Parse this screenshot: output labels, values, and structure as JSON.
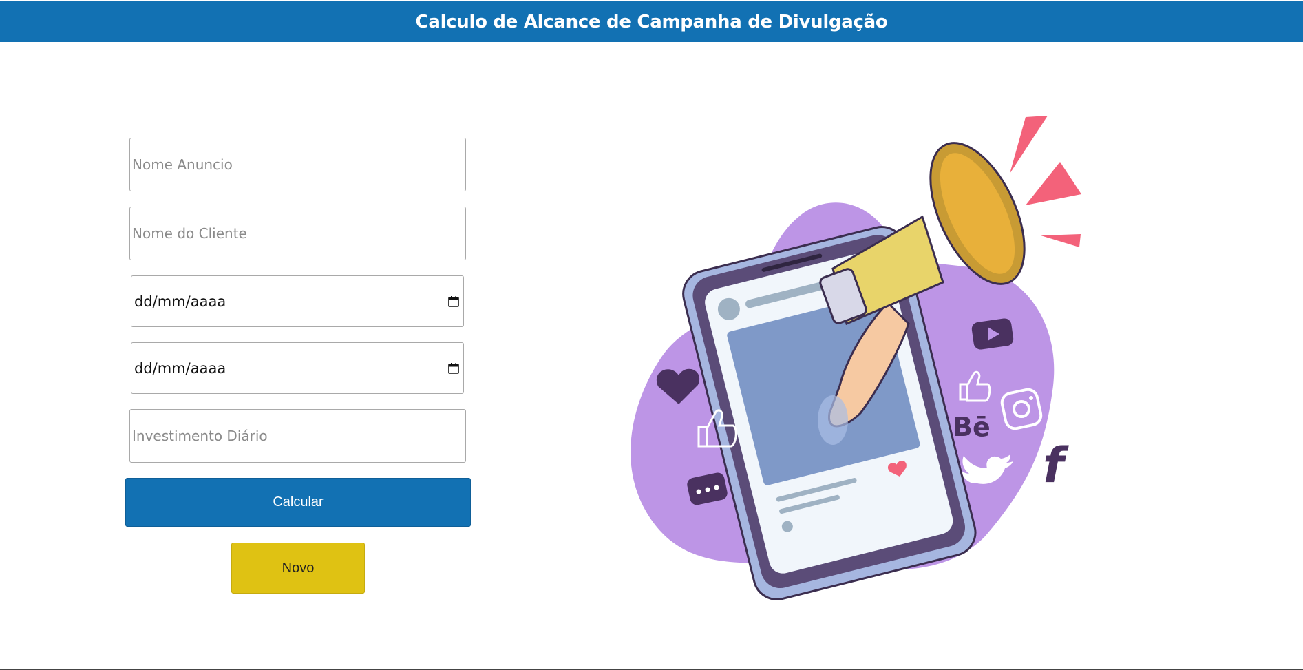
{
  "header": {
    "title": "Calculo de Alcance de Campanha de Divulgação",
    "bg_color": "#1271b3"
  },
  "form": {
    "nome_anuncio": {
      "placeholder": "Nome Anuncio",
      "value": ""
    },
    "nome_cliente": {
      "placeholder": "Nome do Cliente",
      "value": ""
    },
    "data_inicio": {
      "display": "dd/mm/aaaa"
    },
    "data_fim": {
      "display": "dd/mm/aaaa"
    },
    "investimento": {
      "placeholder": "Investimento Diário",
      "value": ""
    },
    "calcular_label": "Calcular",
    "novo_label": "Novo"
  },
  "illustration": {
    "description_icons": [
      "megaphone-icon",
      "phone-icon",
      "heart-icon",
      "thumbs-up-icon",
      "chat-icon",
      "youtube-icon",
      "instagram-icon",
      "behance-icon",
      "twitter-icon",
      "facebook-icon"
    ],
    "behance_text": "Bē",
    "facebook_text": "f",
    "colors": {
      "blob": "#bd95e6",
      "accent_red": "#f3627a",
      "megaphone": "#e8d46a",
      "dark_purple": "#4a3160"
    }
  }
}
